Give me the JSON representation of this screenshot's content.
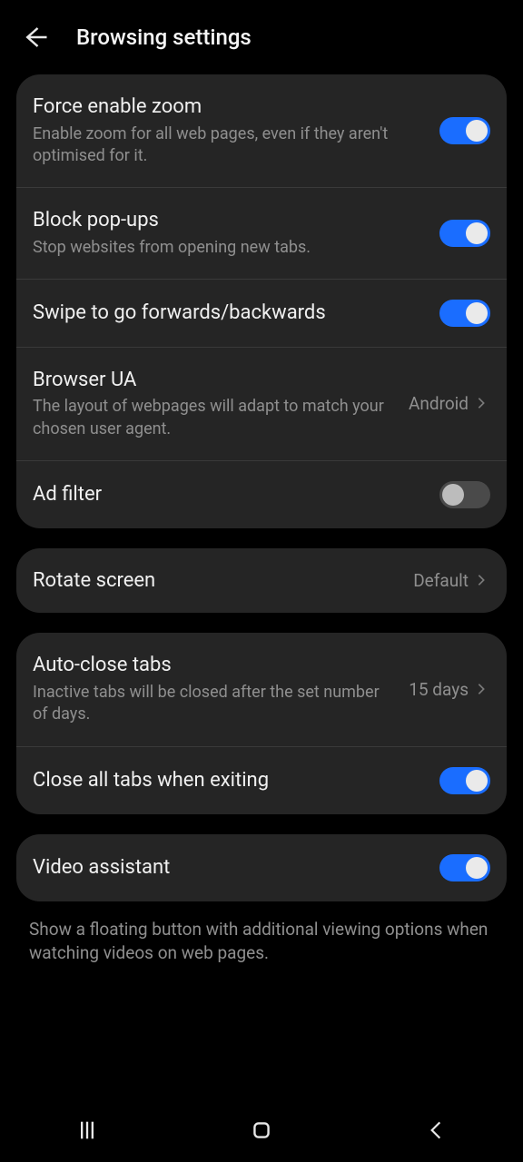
{
  "header": {
    "title": "Browsing settings"
  },
  "group1": {
    "r0": {
      "label": "Force enable zoom",
      "sub": "Enable zoom for all web pages, even if they aren't optimised for it.",
      "on": true
    },
    "r1": {
      "label": "Block pop-ups",
      "sub": "Stop websites from opening new tabs.",
      "on": true
    },
    "r2": {
      "label": "Swipe to go forwards/backwards",
      "on": true
    },
    "r3": {
      "label": "Browser UA",
      "sub": "The layout of webpages will adapt to match your chosen user agent.",
      "value": "Android"
    },
    "r4": {
      "label": "Ad filter",
      "on": false
    }
  },
  "group2": {
    "r0": {
      "label": "Rotate screen",
      "value": "Default"
    }
  },
  "group3": {
    "r0": {
      "label": "Auto-close tabs",
      "sub": "Inactive tabs will be closed after the set number of days.",
      "value": "15 days"
    },
    "r1": {
      "label": "Close all tabs when exiting",
      "on": true
    }
  },
  "group4": {
    "r0": {
      "label": "Video assistant",
      "on": true
    },
    "desc": "Show a floating button with additional viewing options when watching videos on web pages."
  }
}
